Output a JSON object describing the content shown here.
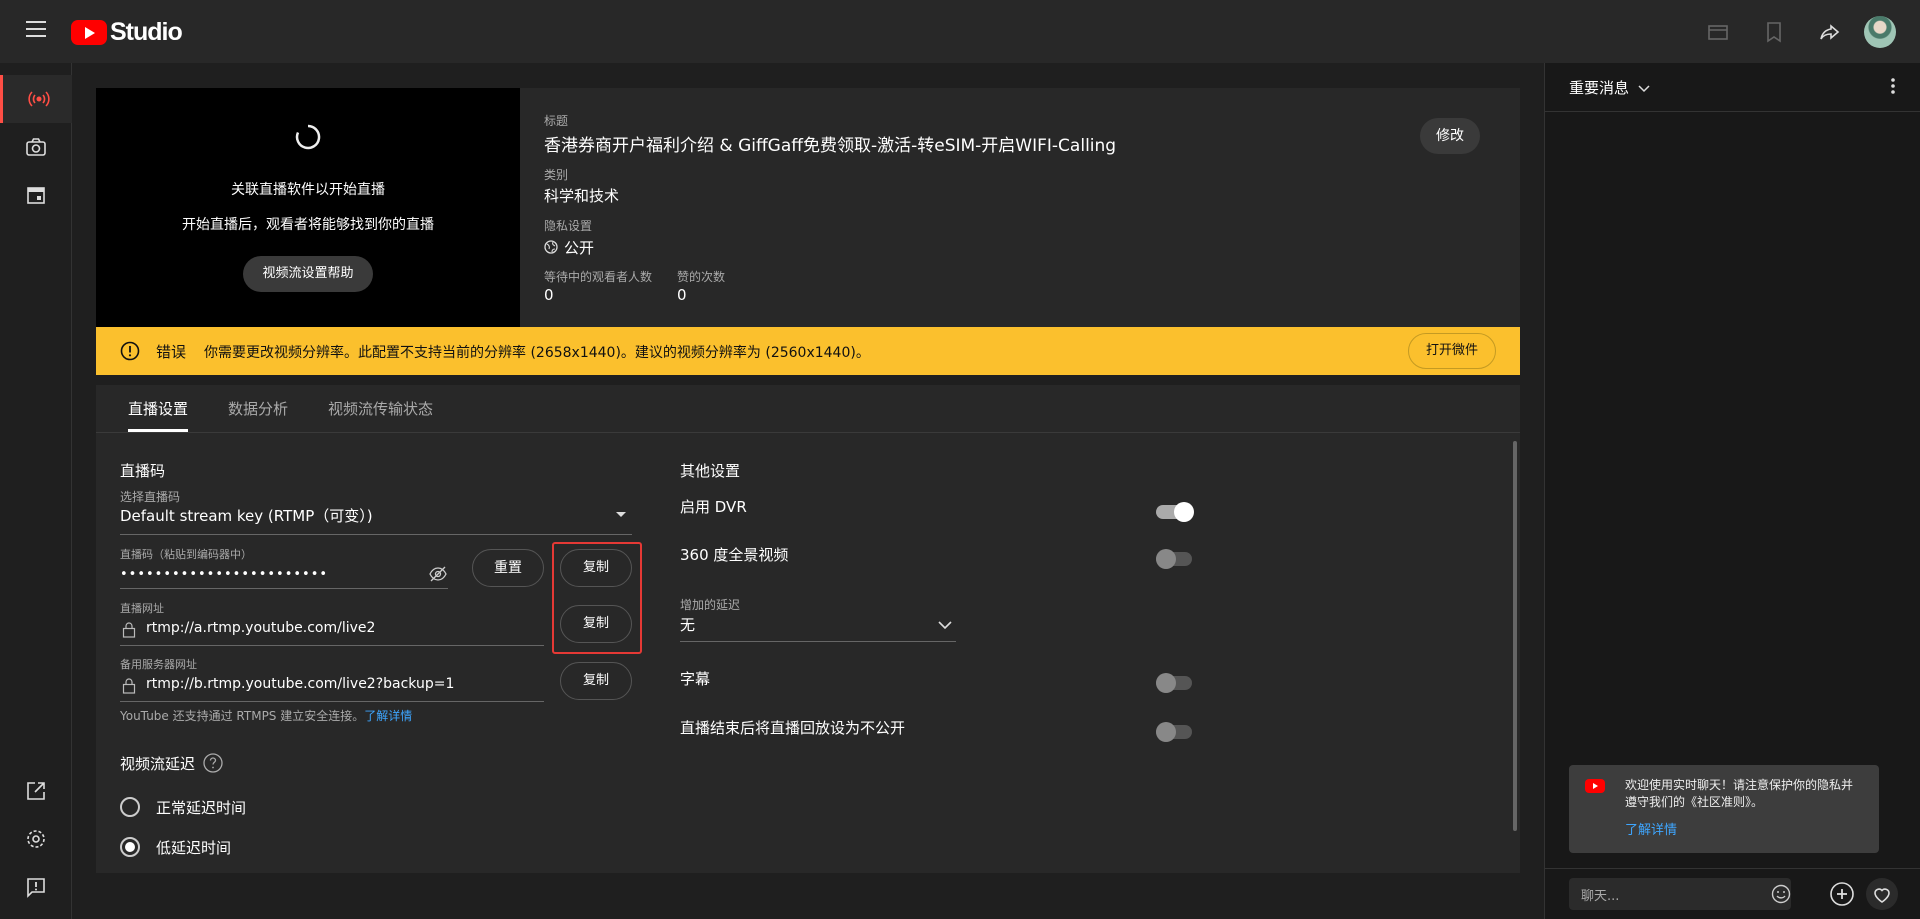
{
  "app": {
    "logo_text": "Studio"
  },
  "preview": {
    "line1": "关联直播软件以开始直播",
    "line2": "开始直播后，观看者将能够找到你的直播",
    "help_button": "视频流设置帮助"
  },
  "info": {
    "title_label": "标题",
    "title": "香港券商开户福利介绍 & GiffGaff免费领取-激活-转eSIM-开启WIFI-Calling",
    "category_label": "类别",
    "category": "科学和技术",
    "privacy_label": "隐私设置",
    "privacy": "公开",
    "waiting_label": "等待中的观看者人数",
    "waiting": "0",
    "likes_label": "赞的次数",
    "likes": "0",
    "edit_button": "修改"
  },
  "error": {
    "prefix": "错误",
    "message": "你需要更改视频分辨率。此配置不支持当前的分辨率 (2658x1440)。建议的视频分辨率为 (2560x1440)。",
    "action": "打开微件"
  },
  "tabs": [
    "直播设置",
    "数据分析",
    "视频流传输状态"
  ],
  "stream": {
    "section_title": "直播码",
    "select_label": "选择直播码",
    "select_value": "Default stream key (RTMP（可变）)",
    "key_label": "直播码（粘贴到编码器中）",
    "key_value": "••••••••••••••••••••••••",
    "reset_button": "重置",
    "copy_button": "复制",
    "url_label": "直播网址",
    "url_value": "rtmp://a.rtmp.youtube.com/live2",
    "backup_label": "备用服务器网址",
    "backup_value": "rtmp://b.rtmp.youtube.com/live2?backup=1",
    "rtmps_note": "YouTube 还支持通过 RTMPS 建立安全连接。",
    "learn_more": "了解详情",
    "latency_title": "视频流延迟",
    "latency_normal": "正常延迟时间",
    "latency_low": "低延迟时间",
    "latency_selected": "低延迟时间"
  },
  "other": {
    "section_title": "其他设置",
    "dvr_label": "启用 DVR",
    "dvr_on": true,
    "vr360_label": "360 度全景视频",
    "vr360_on": false,
    "delay_label": "增加的延迟",
    "delay_value": "无",
    "captions_label": "字幕",
    "captions_on": false,
    "unlist_label": "直播结束后将直播回放设为不公开",
    "unlist_on": false
  },
  "chat": {
    "header": "重要消息",
    "welcome": "欢迎使用实时聊天！请注意保护你的隐私并遵守我们的《社区准则》。",
    "learn_more": "了解详情",
    "placeholder": "聊天..."
  },
  "colors": {
    "error_bar": "#fbc02d",
    "highlight_box": "#e53935",
    "link": "#3ea6ff",
    "live_red": "#ff4e45"
  }
}
